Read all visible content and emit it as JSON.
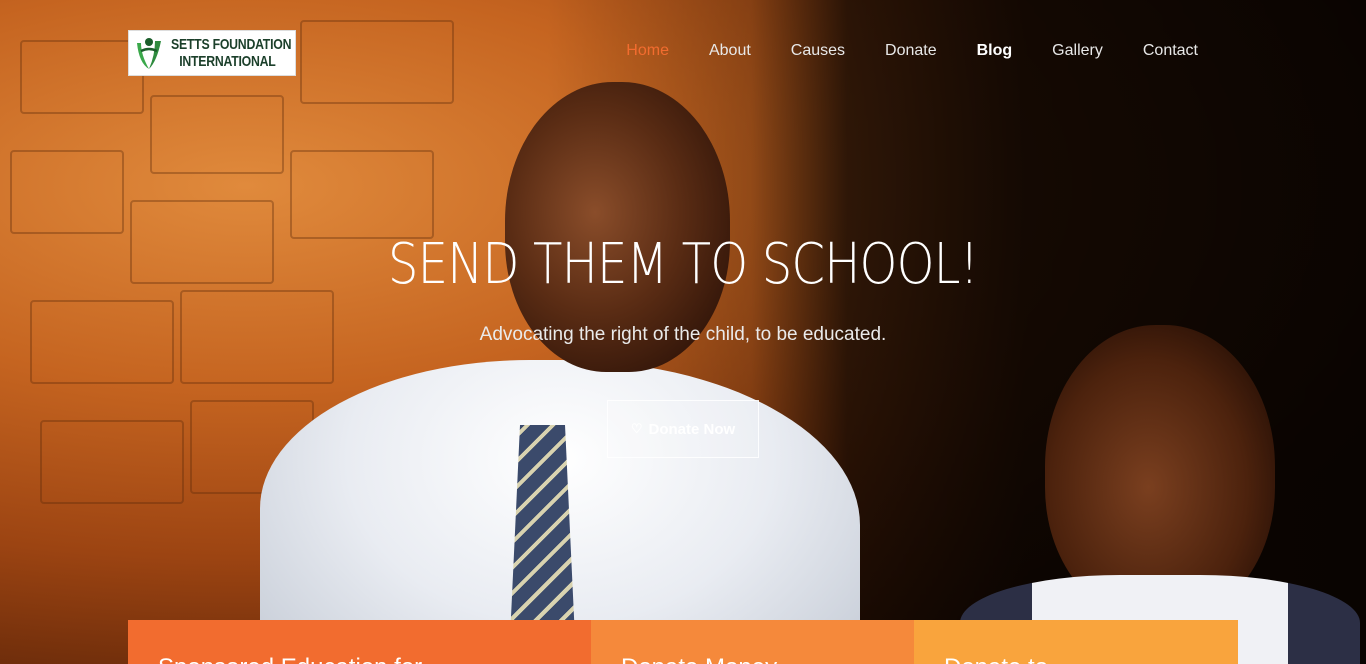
{
  "logo": {
    "line1": "SETTS FOUNDATION",
    "line2": "INTERNATIONAL"
  },
  "nav": {
    "items": [
      {
        "label": "Home"
      },
      {
        "label": "About"
      },
      {
        "label": "Causes"
      },
      {
        "label": "Donate"
      },
      {
        "label": "Blog"
      },
      {
        "label": "Gallery"
      },
      {
        "label": "Contact"
      }
    ]
  },
  "hero": {
    "title": "SEND THEM TO SCHOOL!",
    "subtitle": "Advocating the right of the child, to be educated.",
    "button_icon": "heart-icon",
    "button_label": "Donate Now"
  },
  "features": [
    {
      "label": "Sponsored Education for"
    },
    {
      "label": "Donate Money"
    },
    {
      "label": "Donate to"
    }
  ],
  "colors": {
    "accent": "#f26c2f",
    "feature1": "#f26c2f",
    "feature2": "#f5893b",
    "feature3": "#f9a43d"
  }
}
